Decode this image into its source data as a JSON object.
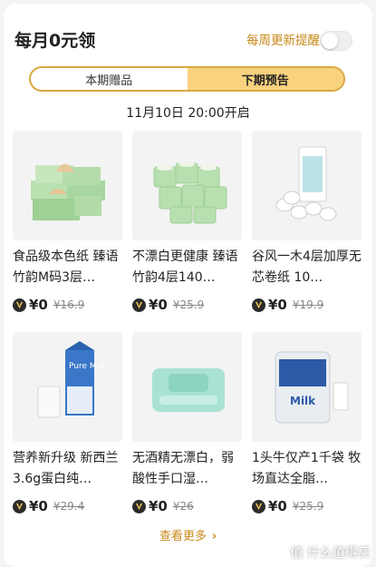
{
  "header": {
    "title": "每月0元领",
    "remind_label": "每周更新提醒"
  },
  "tabs": [
    {
      "label": "本期赠品",
      "active": false
    },
    {
      "label": "下期预告",
      "active": true
    }
  ],
  "schedule": "11月10日 20:00开启",
  "products": [
    {
      "name": "食品级本色纸 臻语竹韵M码3层…",
      "price": "¥0",
      "original_price": "¥16.9"
    },
    {
      "name": "不漂白更健康 臻语竹韵4层140…",
      "price": "¥0",
      "original_price": "¥25.9"
    },
    {
      "name": "谷风一木4层加厚无芯卷纸 10…",
      "price": "¥0",
      "original_price": "¥19.9"
    },
    {
      "name": "营养新升级 新西兰3.6g蛋白纯…",
      "price": "¥0",
      "original_price": "¥29.4"
    },
    {
      "name": "无酒精无漂白，弱酸性手口湿…",
      "price": "¥0",
      "original_price": "¥26"
    },
    {
      "name": "1头牛仅产1千袋 牧场直达全脂…",
      "price": "¥0",
      "original_price": "¥25.9"
    }
  ],
  "product_images": {
    "p4_brand": "Pure Milk",
    "p6_brand": "Milk"
  },
  "more_label": "查看更多",
  "watermark": "值 什么值得买",
  "colors": {
    "accent": "#c9891a",
    "tab_active": "#f9d27e",
    "tab_border": "#d9a83f"
  }
}
